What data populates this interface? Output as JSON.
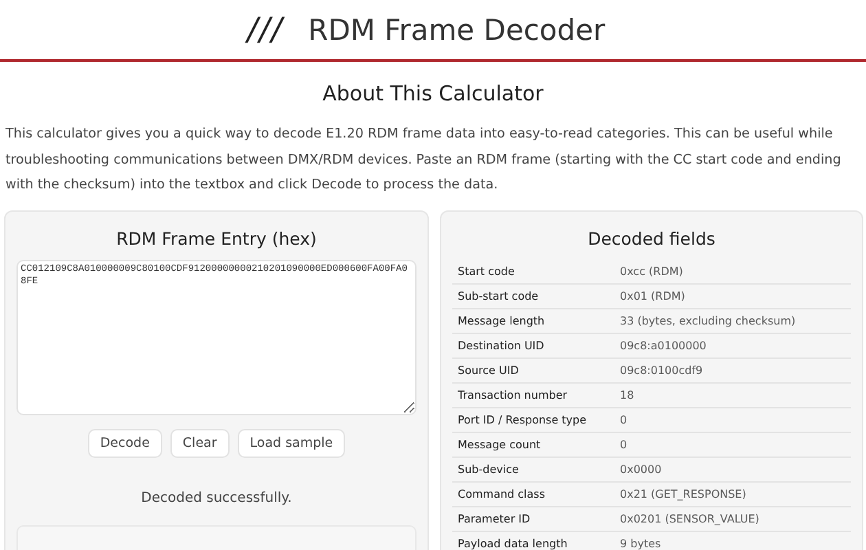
{
  "header": {
    "logo": "///",
    "title": "RDM Frame Decoder"
  },
  "about": {
    "heading": "About This Calculator",
    "text": "This calculator gives you a quick way to decode E1.20 RDM frame data into easy-to-read categories. This can be useful while troubleshooting communications between DMX/RDM devices. Paste an RDM frame (starting with the CC start code and ending with the checksum) into the textbox and click Decode to process the data."
  },
  "entry": {
    "heading": "RDM Frame Entry (hex)",
    "value": "CC012109C8A010000009C80100CDF91200000000210201090000ED000600FA00FA08FE",
    "buttons": [
      "Decode",
      "Clear",
      "Load sample"
    ],
    "status": "Decoded successfully."
  },
  "decoded": {
    "heading": "Decoded fields",
    "rows": [
      {
        "label": "Start code",
        "value": "0xcc (RDM)"
      },
      {
        "label": "Sub-start code",
        "value": "0x01 (RDM)"
      },
      {
        "label": "Message length",
        "value": "33 (bytes, excluding checksum)"
      },
      {
        "label": "Destination UID",
        "value": "09c8:a0100000"
      },
      {
        "label": "Source UID",
        "value": "09c8:0100cdf9"
      },
      {
        "label": "Transaction number",
        "value": "18"
      },
      {
        "label": "Port ID / Response type",
        "value": "0"
      },
      {
        "label": "Message count",
        "value": "0"
      },
      {
        "label": "Sub-device",
        "value": "0x0000"
      },
      {
        "label": "Command class",
        "value": "0x21 (GET_RESPONSE)"
      },
      {
        "label": "Parameter ID",
        "value": "0x0201 (SENSOR_VALUE)"
      },
      {
        "label": "Payload data length",
        "value": "9 bytes"
      }
    ]
  }
}
